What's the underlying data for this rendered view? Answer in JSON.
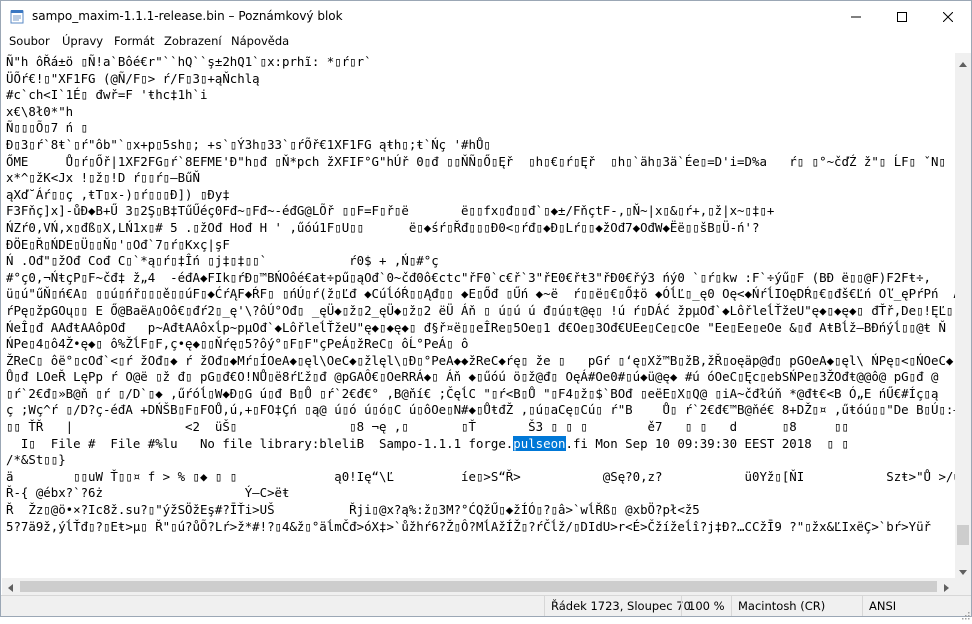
{
  "window": {
    "title": "sampo_maxim-1.1.1-release.bin – Poznámkový blok",
    "icons": {
      "app": "notepad-icon",
      "minimize": "minimize-icon",
      "maximize": "maximize-icon",
      "close": "close-icon"
    }
  },
  "menu": {
    "items": [
      "Soubor",
      "Úpravy",
      "Formát",
      "Zobrazení",
      "Nápověda"
    ]
  },
  "editor": {
    "lines": [
      "Ñ\"h ôŘá±ö ▯Ñ!a`Bôé€r\"``hQ``ş±2hQ1`▯x:prhĩ: *▯ŕ▯r`",
      "ÜÕŕ€!▯\"XF1FG (@Ñ/F▯> ŕ/F▯3▯+ąŇchlą",
      "#c`ch<I`1É▯ đwř=F 'ŧhc‡1h`i",
      "x€\\8ł0*\"h",
      "Ñ▯▯▯Õ▯7 ń ▯",
      "Ð▯3▯ŕ`8ŧ`▯ŕ\"ôb\"`▯x+p▯5sh▯; +s`▯Ý3h▯33`▯ŕÕř€1XF1FG ąŧh▯;ŧ`Ńç '#hŮ▯",
      "ŐME     Ů▯ŕ▯Őř|1XF2FG▯ŕ`8EFME'Ð\"h▯đ ▯Ň*pch žXFIF°G\"hÚř 0▯đ ▯▯ŇÑ▯Ő▯Ęř  ▯h▯€▯ŕ▯Ęř  ▯h▯`äh▯3ä`Ée▯=D'i=D%a   ŕ▯ ▯°~čďŹ ž\"▯ ĹF▯ ˇN▯ °",
      "x*^▯žK<Jx !▯ž▯!D ŕ▯▯ŕ▯–BűŇ",
      "ąXď˘Áŕ▯▯ç ‚ŧT▯x-)▯ŕ▯▯▯Đ]) ▯Đy‡",
      "F3Fňç]x]-ůĐ◆B+Ű 3▯2Ş▯B‡TűŰéç0Fđ~▯Fđ~-éđG@LÕř ▯▯F=F▯ř▯ë       ë▯▯fx▯đ▯▯đ`▯◆±/FňçtF-,▯Ň~|x▯&▯ŕ+,▯ž|x~▯‡▯+",
      "ŃZŕ0,VŃ,x▯đß▯X,LŃ1x▯# 5 .▯žOđ Hođ H ' ‚űóú1F▯U▯▯      ë▯◆śŕ▯Řđ▯▯▯Đ0<▯ŕđ▯◆Đ▯Lŕ▯▯◆žOđ7◆OđW◆Ëë▯▯šB▯Ü-ń'?",
      "ĐÖE▯Ř▯ŃDE▯Ü▯▯Ň▯'▯Ođ`7▯ŕ▯Kxç|şF",
      "Ń .Ođ\"▯žOđ Cođ C▯`*ą▯ŕ▯‡Îń ▯j‡▯‡▯▯`           ŕ0$ + ‚Ń▯#°ç",
      "#°ç0,¬ŃŧçP▯F~čđ‡ ž„4  -éđA◆FIk▯ŕĐ▯™BŃOôé€aŧ÷pű▯ąOđ`0~čđ0ô€ctc\"řF0`c€ř`3\"řE0€řŧ3\"řĐ0€řý3 ńý0 `▯ŕ▯kw :F`÷ýű▯F (BĐ ë▯▯@F)F2Fŧ÷,",
      "ü▯ú\"űŇ▯ń€A▯ ▯▯ú▯ńř▯▯▯ě▯▯úF▯◆ĆŕĄF◆ŔF▯ ▯ńÚ▯ŕ(ž▯Ľđ ◆CúĺóŔ▯▯Ąđ▯▯ ◆E▯Őđ ▯Űń ◆~ë  ŕ▯▯ë▯€▯Ő‡ö ◆ÓĺĽ▯_ę0 Oę<◆ŃŕĺIOęDŔ▯€▯đš€Ľń Oľ_ęPŕPń  Ań",
      "ŕPę▯žpGOų▯▯ E Ő@BaëA▯Oô€▯đŕ2▯_ę'\\?ôÚ°Ođ▯ _ęÜ◆▯ž▯2_ęÜ◆▯ž▯2 ëÜ Áň ▯ ú▯ú ú đ▯ú▯ŧ@ę▯ !ú ŕ▯DÁć žpµOđ`◆LôřleĺŤžeU\"ę◆▯◆ę◆▯ đŤř,De▯!ĘĽ▯",
      "ŃeÎ▯đ AAđŧAAôpOđ   p~AđŧAAôxĺp~pµOđ`◆LôřleĺŤžeU\"ę◆▯◆ę◆▯ đ§ř¤ë▯▯eÎRe▯5Oe▯1 đ€Oe▯3Ođ€UEe▯Ce▯cOe \"Ee▯Ee▯eOe &▯đ AŧBĺž–BĐńýĺ▯▯@ŧ Ň",
      "ŃPe▯4▯ô4Ž•ę◆▯ ô%ŽĺF▯F,ç•ę◆▯▯Ňŕę▯5?ôý°▯F▯F\"çPeÁ▯žReC▯ ôĹ°PeÁ▯ ô",
      "ŽReC▯ ôë°▯cOđ`<▯ŕ žOđ▯◆ ŕ žOđ▯◆Mŕ▯ÍOeA◆▯ęl\\OeC◆▯žlęl\\▯Đ▯°PeA◆◆žReC◆ŕę▯ že ▯   pGŕ ▯‘ę▯Xž™B▯žB,žŘ▯oęäp@đ▯ pGOeA◆▯ęl\\ ŃPę▯<▯ŃOeC◆",
      "Ů▯đ LOeŘ LęPp ŕ O@ë ▯ž đ▯ pG▯đ€O!NŮ▯ë8ŕĽž▯đ @pGAÔ€▯OeRRÁ◆▯ Áň ◆▯űóú ö▯ž@đ▯ OęÁ#Oe0#▯ú◆ü@ę◆ #ú óOeC▯Ęc▯ebSŃPe▯3ŽOđŧ@@ô@ pG▯đ @",
      "▯ŕ`2€đ▯»B@ň ▯ŕ ▯/D`▯◆ ‚űŕóĺ▯W◆Đ▯G ú▯đ B▯Ů ▯ŕ`2€đ€° ‚B@ňí€ ;ČęĺC \"▯ŕ<B▯Ů \"▯F4▯ž▯$`BOđ ▯eëE▯X▯Q@ ▯iA~čđłúň *@đŧ€<B Ó„E ńŰ€#Íç▯ą",
      "ç ;Wç^ŕ ▯/D?ç-éđA +DŃŠB▯F▯FOŮ‚ú,+▯FO‡Çń ▯ą@ ú▯ó ú▯ó▯C ú▯ôOe▯N#◆▯ŮŧđŽ ‚▯ú▯aCę▯Cú▯ ŕ\"B    Ů▯ ŕ`2€đ€™B@ňé€ 8+DŽ▯¤ ‚űŧóú▯▯\"De B▯Ú▯:–",
      "▯▯ ŤŘ   |               <2  üŠ▯               ▯8 ¬ę ‚▯       ▯Ť       Š3 ▯ ▯ ▯        ě7   ▯ ▯   d      ▯8     ▯▯",
      "  I▯  File #  File #%lu   No file library:bleliB  Sampo-1.1.1 forge.pulseon.fi Mon Sep 10 09:39:30 EEST 2018  ▯ ▯",
      "/*&St▯▯}",
      "ä        ▯▯uW Ť▯▯¤ f > % ▯◆ ▯ ▯             ą0!Ię“\\Ľ         íe▯>S“Ř>           @Sę?0,z?           ü0Yž▯[ŇI           Szŧ>\"Ů >/ů",
      "Ř-{ @ébx?`?6ż                   Ý–C>ëŧ",
      "Ř  Žz▯@ö•×?Ic8ž.su?▯\"ýžSÖžEş#?ĪŤi>UŠ          Řji▯@x?ą%:ž▯3M?°ĆQžŰ▯◆žÍÓ▯?▯â>`wĺŘß▯ @xbÖ?pł<ž5",
      "5?7ä9ž,ýĺŤđ▯?▯Eŧ>µ▯ Ř\"▯ú?ůÕ?Lŕ>ž*#!?▯4&ž▯°äĺmČđ>óX‡>`ůžhŕ6?Ž▯Ô?MĺAžÍŽ▯?ŕČĺž/▯DIdU>r<É>Čžížeĺî?j‡Đ?…CCžĪ9 ?\"▯žx&ĽIxëÇ>`bŕ>Yüř"
    ],
    "selected_word": "pulseon",
    "selected_line_index": 23
  },
  "scrollbars": {
    "up": "scroll-up-arrow-icon",
    "down": "scroll-down-arrow-icon",
    "left": "scroll-left-arrow-icon",
    "right": "scroll-right-arrow-icon"
  },
  "statusbar": {
    "position": "Řádek 1723, Sloupec 70",
    "zoom": "100 %",
    "line_endings": "Macintosh (CR)",
    "encoding": "ANSI"
  },
  "colors": {
    "selection": "#0078d7",
    "status_bg": "#f0f0f0",
    "scroll_thumb": "#cdcdcd"
  }
}
